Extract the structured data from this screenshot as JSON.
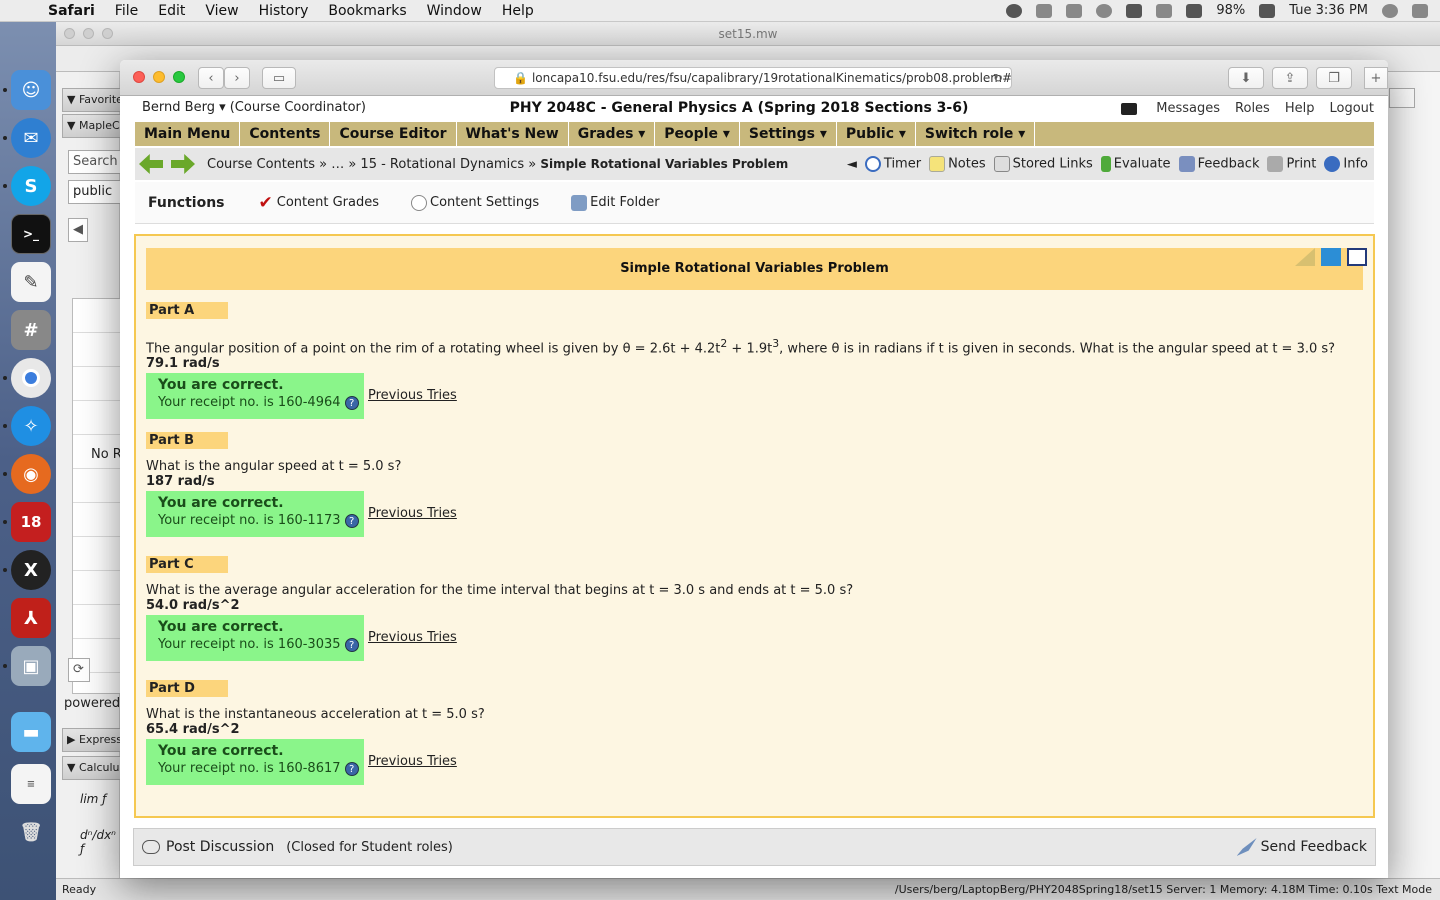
{
  "menubar": {
    "app": "Safari",
    "items": [
      "File",
      "Edit",
      "View",
      "History",
      "Bookmarks",
      "Window",
      "Help"
    ],
    "battery": "98%",
    "clock": "Tue 3:36 PM"
  },
  "maple": {
    "title": "set15.mw",
    "palettes": [
      "Favorites",
      "MapleCl",
      "Expressi",
      "Calculus"
    ],
    "search_placeholder": "Search",
    "public_field": "public",
    "list_text": "No R",
    "powered": "powered",
    "status_left": "Ready",
    "status_right": "/Users/berg/LaptopBerg/PHY2048Spring18/set15   Server: 1   Memory: 4.18M   Time: 0.10s   Text Mode"
  },
  "safari": {
    "url": "loncapa10.fsu.edu/res/fsu/capalibrary/19rotationalKinematics/prob08.problem#"
  },
  "lc": {
    "user": "Bernd Berg ▾ (Course Coordinator)",
    "course": "PHY 2048C - General Physics A (Spring 2018 Sections 3-6)",
    "toplinks": [
      "Messages",
      "Roles",
      "Help",
      "Logout"
    ],
    "mainmenu": [
      "Main Menu",
      "Contents",
      "Course Editor",
      "What's New",
      "Grades ▾",
      "People ▾",
      "Settings ▾",
      "Public ▾",
      "Switch role ▾"
    ],
    "breadcrumb": {
      "part1": "Course Contents » … » 15 - Rotational Dynamics » ",
      "current": "Simple Rotational Variables Problem"
    },
    "tools": {
      "collapse": "◄",
      "timer": "Timer",
      "notes": "Notes",
      "stored_links": "Stored Links",
      "evaluate": "Evaluate",
      "feedback": "Feedback",
      "print": "Print",
      "info": "Info"
    },
    "functions": {
      "title": "Functions",
      "content_grades": "Content Grades",
      "content_settings": "Content Settings",
      "edit_folder": "Edit Folder"
    },
    "problem_title": "Simple Rotational Variables Problem",
    "parts": [
      {
        "label": "Part A",
        "question_pre": "The angular position of a point on the rim of a rotating wheel is given by θ = 2.6t + 4.2t",
        "sup1": "2",
        "question_mid": " + 1.9t",
        "sup2": "3",
        "question_post": ", where θ is in radians if t is given in seconds. What is the angular speed at t = 3.0 s?",
        "answer": "79.1 rad/s",
        "correct": "You are correct.",
        "receipt": "Your receipt no. is 160-4964",
        "prev": "Previous Tries"
      },
      {
        "label": "Part B",
        "question": "What is the angular speed at t = 5.0 s?",
        "answer": "187 rad/s",
        "correct": "You are correct.",
        "receipt": "Your receipt no. is 160-1173",
        "prev": "Previous Tries"
      },
      {
        "label": "Part C",
        "question": "What is the average angular acceleration for the time interval that begins at t = 3.0 s and ends at t = 5.0 s?",
        "answer": "54.0 rad/s^2",
        "correct": "You are correct.",
        "receipt": "Your receipt no. is 160-3035",
        "prev": "Previous Tries"
      },
      {
        "label": "Part D",
        "question": "What is the instantaneous acceleration at t = 5.0 s?",
        "answer": "65.4 rad/s^2",
        "correct": "You are correct.",
        "receipt": "Your receipt no. is 160-8617",
        "prev": "Previous Tries"
      }
    ],
    "post_discussion": "Post Discussion",
    "closed_note": "(Closed for Student roles)",
    "send_feedback": "Send Feedback"
  },
  "colors": {
    "menu_bar_bg": "#c8b87c",
    "problem_header": "#fcd57c",
    "correct_bg": "#8af58a",
    "content_border": "#f5c851"
  }
}
